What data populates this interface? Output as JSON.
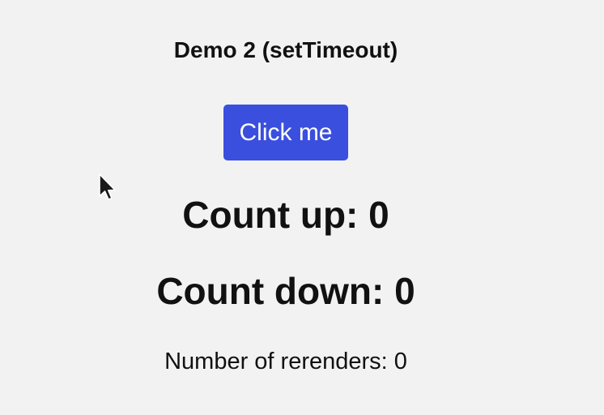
{
  "heading": "Demo 2 (setTimeout)",
  "button_label": "Click me",
  "count_up": "Count up: 0",
  "count_down": "Count down: 0",
  "rerenders": "Number of rerenders: 0",
  "colors": {
    "background": "#f2f2f2",
    "button": "#3a4fde",
    "text": "#111111"
  },
  "icons": {
    "cursor": "mouse-pointer-icon"
  }
}
